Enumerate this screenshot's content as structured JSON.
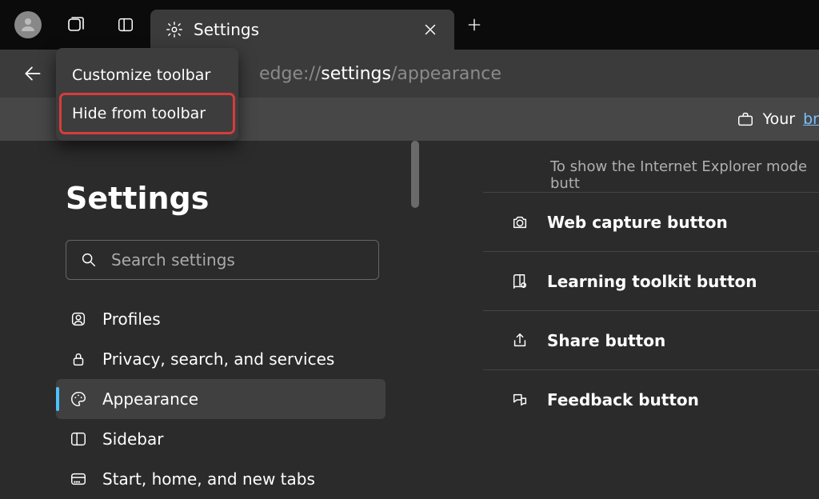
{
  "titlebar": {
    "tab_title": "Settings"
  },
  "context_menu": {
    "customize": "Customize toolbar",
    "hide": "Hide from toolbar"
  },
  "address": {
    "prefix": "edge://",
    "bold": "settings",
    "suffix": "/appearance"
  },
  "infobar": {
    "your": "Your",
    "link_partial": "br"
  },
  "sidebar": {
    "heading": "Settings",
    "search_placeholder": "Search settings",
    "items": [
      {
        "label": "Profiles"
      },
      {
        "label": "Privacy, search, and services"
      },
      {
        "label": "Appearance"
      },
      {
        "label": "Sidebar"
      },
      {
        "label": "Start, home, and new tabs"
      }
    ]
  },
  "main": {
    "hint": "To show the Internet Explorer mode butt",
    "rows": [
      {
        "label": "Web capture button"
      },
      {
        "label": "Learning toolkit button"
      },
      {
        "label": "Share button"
      },
      {
        "label": "Feedback button"
      }
    ]
  }
}
